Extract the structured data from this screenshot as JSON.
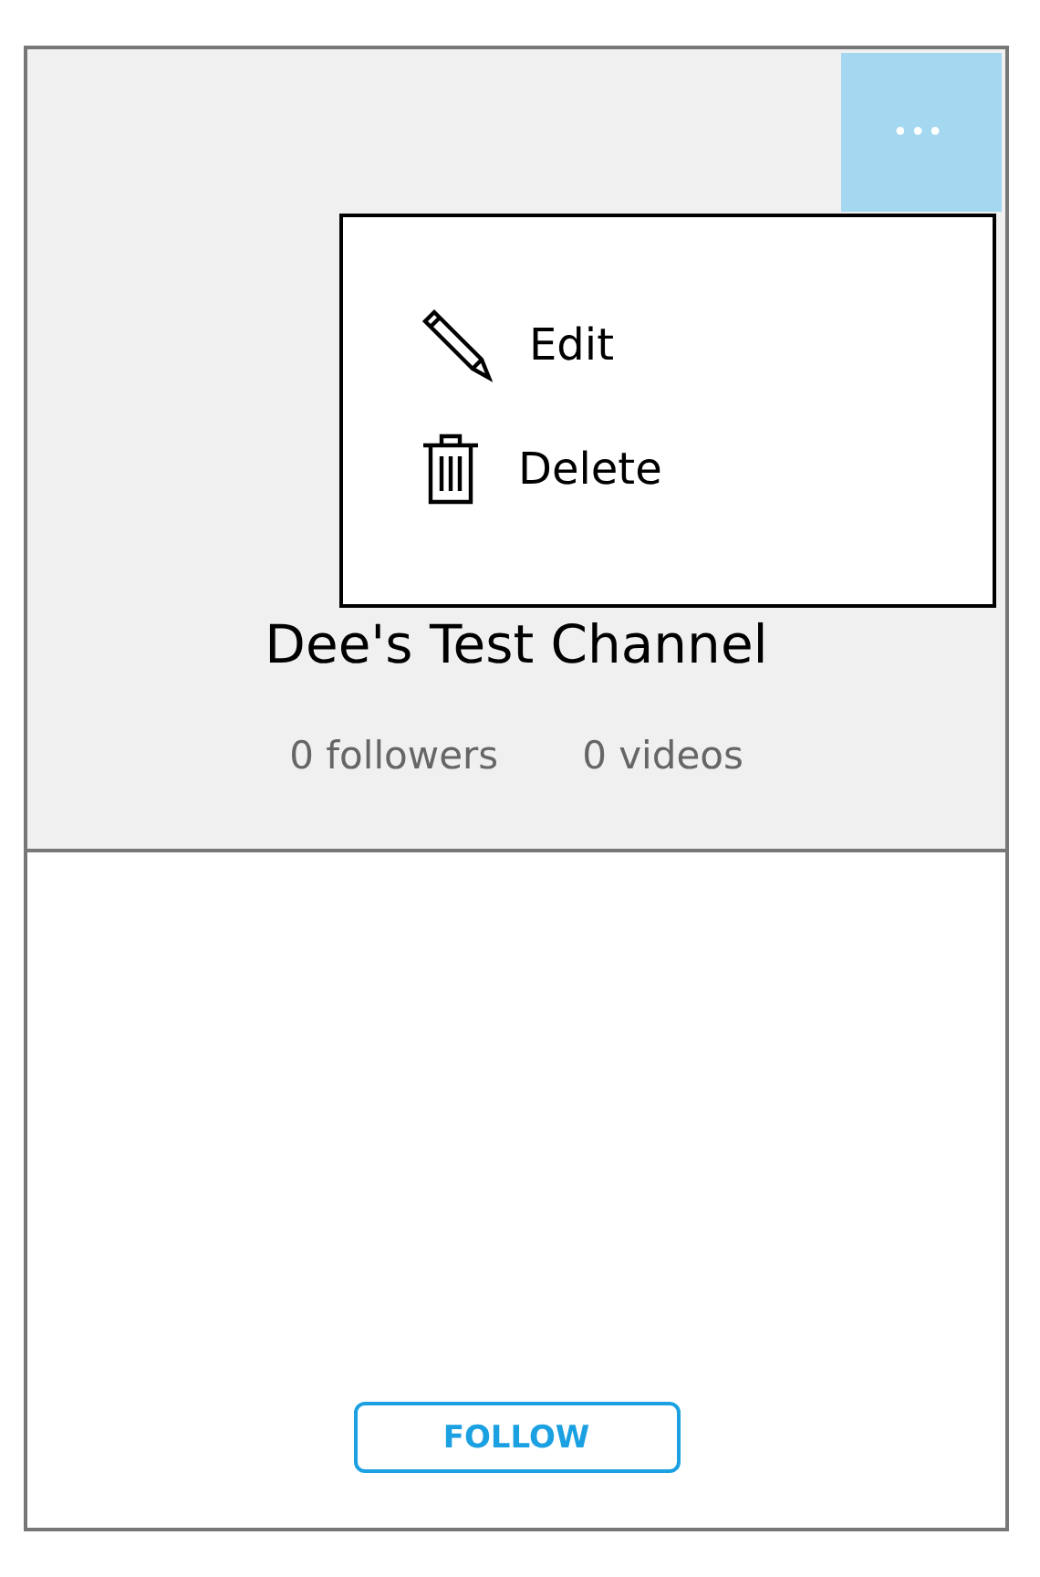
{
  "channel": {
    "title": "Dee's Test Channel",
    "followers": "0 followers",
    "videos": "0 videos"
  },
  "more_button": {
    "label": "•••"
  },
  "menu": {
    "open": true,
    "items": [
      {
        "kind": "edit",
        "label": "Edit"
      },
      {
        "kind": "delete",
        "label": "Delete"
      }
    ]
  },
  "follow_button": {
    "label": "FOLLOW"
  }
}
